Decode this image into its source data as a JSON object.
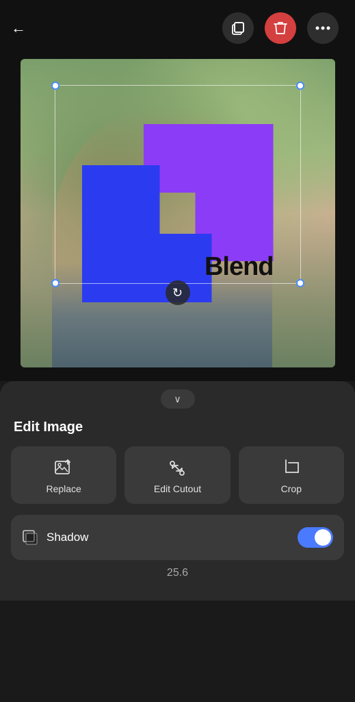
{
  "header": {
    "back_label": "←",
    "copy_icon": "copy-icon",
    "delete_icon": "trash-icon",
    "more_icon": "more-icon"
  },
  "canvas": {
    "blend_text": "Blend",
    "rotate_icon": "↻"
  },
  "panel": {
    "chevron": "∨",
    "section_title": "Edit Image",
    "tools": [
      {
        "id": "replace",
        "icon": "⊞",
        "label": "Replace"
      },
      {
        "id": "edit-cutout",
        "icon": "✂",
        "label": "Edit Cutout"
      },
      {
        "id": "crop",
        "icon": "⊡",
        "label": "Crop"
      }
    ],
    "shadow": {
      "label": "Shadow",
      "value": "25.6",
      "enabled": true
    }
  }
}
